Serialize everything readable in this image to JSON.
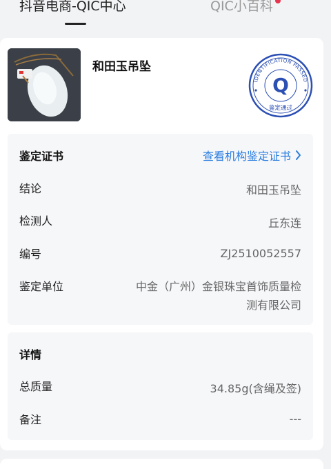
{
  "tabs": [
    {
      "label": "抖音电商-QIC中心",
      "active": true
    },
    {
      "label": "QIC小百科",
      "active": false,
      "has_badge": true
    }
  ],
  "product": {
    "name": "和田玉吊坠",
    "seal_text": "IDENTIFICATION PASSED",
    "seal_bottom": "鉴定通过",
    "seal_letter": "Q"
  },
  "certificate": {
    "title": "鉴定证书",
    "link_label": "查看机构鉴定证书",
    "rows": [
      {
        "label": "结论",
        "value": "和田玉吊坠"
      },
      {
        "label": "检测人",
        "value": "丘东连"
      },
      {
        "label": "编号",
        "value": "ZJ2510052557"
      },
      {
        "label": "鉴定单位",
        "value_line1": "中金（广州）金银珠宝首饰质量检",
        "value_line2": "测有限公司"
      }
    ]
  },
  "details": {
    "title": "详情",
    "rows": [
      {
        "label": "总质量",
        "value": "34.85g(含绳及签)"
      },
      {
        "label": "备注",
        "value": "---"
      }
    ]
  },
  "colors": {
    "accent": "#2a7de1",
    "seal": "#2b4fb3",
    "badge": "#e8344e"
  }
}
